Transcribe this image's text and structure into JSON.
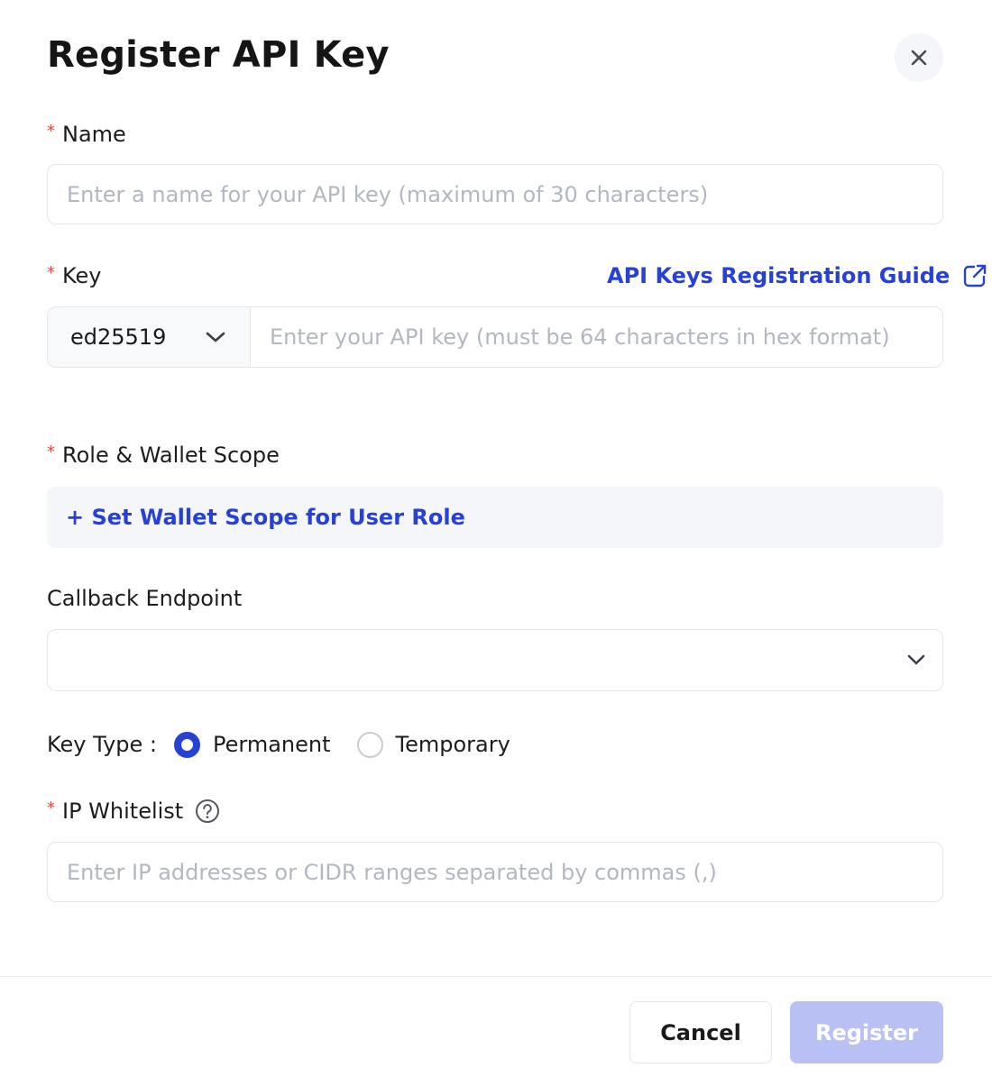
{
  "dialog": {
    "title": "Register API Key",
    "close_icon": "close-icon"
  },
  "name_field": {
    "label": "Name",
    "required_mark": "*",
    "placeholder": "Enter a name for your API key (maximum of 30 characters)",
    "value": ""
  },
  "key_field": {
    "label": "Key",
    "required_mark": "*",
    "guide_link": "API Keys Registration Guide",
    "guide_icon": "external-link-icon",
    "algorithm_selected": "ed25519",
    "placeholder": "Enter your API key (must be 64 characters in hex format)",
    "value": ""
  },
  "scope_field": {
    "label": "Role & Wallet Scope",
    "required_mark": "*",
    "action": "+ Set Wallet Scope for User Role"
  },
  "callback_field": {
    "label": "Callback Endpoint",
    "selected": ""
  },
  "key_type": {
    "label": "Key Type :",
    "options": [
      {
        "label": "Permanent",
        "checked": true
      },
      {
        "label": "Temporary",
        "checked": false
      }
    ]
  },
  "ip_field": {
    "label": "IP Whitelist",
    "required_mark": "*",
    "help_icon": "question-circle-icon",
    "placeholder": "Enter IP addresses or CIDR ranges separated by commas (,)",
    "value": ""
  },
  "footer": {
    "cancel_label": "Cancel",
    "register_label": "Register"
  },
  "colors": {
    "accent": "#2741d6",
    "required": "#e5483f",
    "register_disabled": "#b9c0f3"
  }
}
